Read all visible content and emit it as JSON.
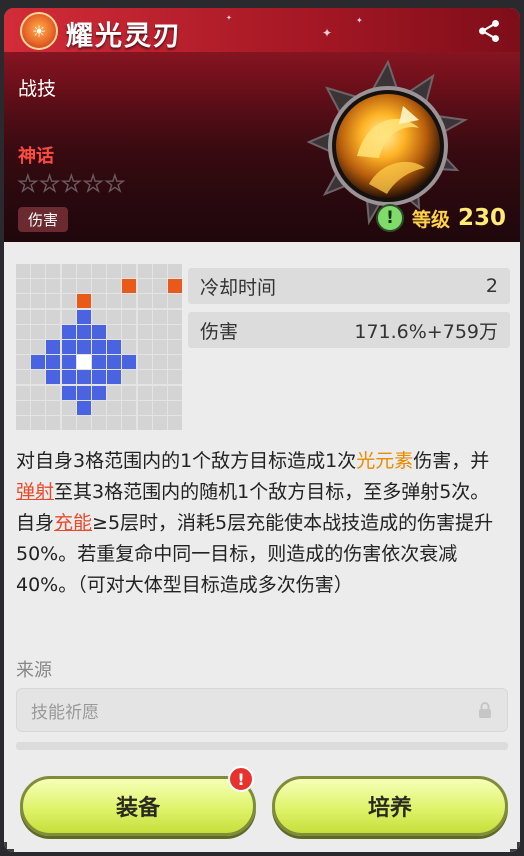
{
  "title": "耀光灵刃",
  "category": "战技",
  "rarity": "神话",
  "stars": 5,
  "stars_filled": 0,
  "tag": "伤害",
  "level": {
    "label": "等级",
    "value": "230"
  },
  "stats": [
    {
      "label": "冷却时间",
      "value": "2"
    },
    {
      "label": "伤害",
      "value": "171.6%+759万"
    }
  ],
  "range_grid": {
    "size": 11,
    "rows": [
      "...........",
      ".......o..o",
      "....o......",
      "....b......",
      "...bbb.....",
      "..bbbbb....",
      ".bbbwbbb...",
      "..bbbbb....",
      "...bbb.....",
      "....b......",
      "..........."
    ]
  },
  "description": {
    "p1": "对自身3格范围内的1个敌方目标造成1次",
    "kw1": "光元素",
    "p2": "伤害，并",
    "kw2": "弹射",
    "p3": "至其3格范围内的随机1个敌方目标，至多弹射5次。自身",
    "kw3": "充能",
    "p4": "≥5层时，消耗5层充能使本战技造成的伤害提升50%。若重复命中同一目标，则造成的伤害依次衰减40%。（可对大体型目标造成多次伤害）"
  },
  "source": {
    "label": "来源",
    "value": "技能祈愿"
  },
  "buttons": {
    "equip": "装备",
    "train": "培养"
  },
  "colors": {
    "header_red": "#b21e2b",
    "rarity_red": "#ff4b3f",
    "level_yellow": "#ffe977",
    "button_green": "#dff36a",
    "range_blue": "#4a63e0",
    "range_orange": "#e9591a"
  }
}
